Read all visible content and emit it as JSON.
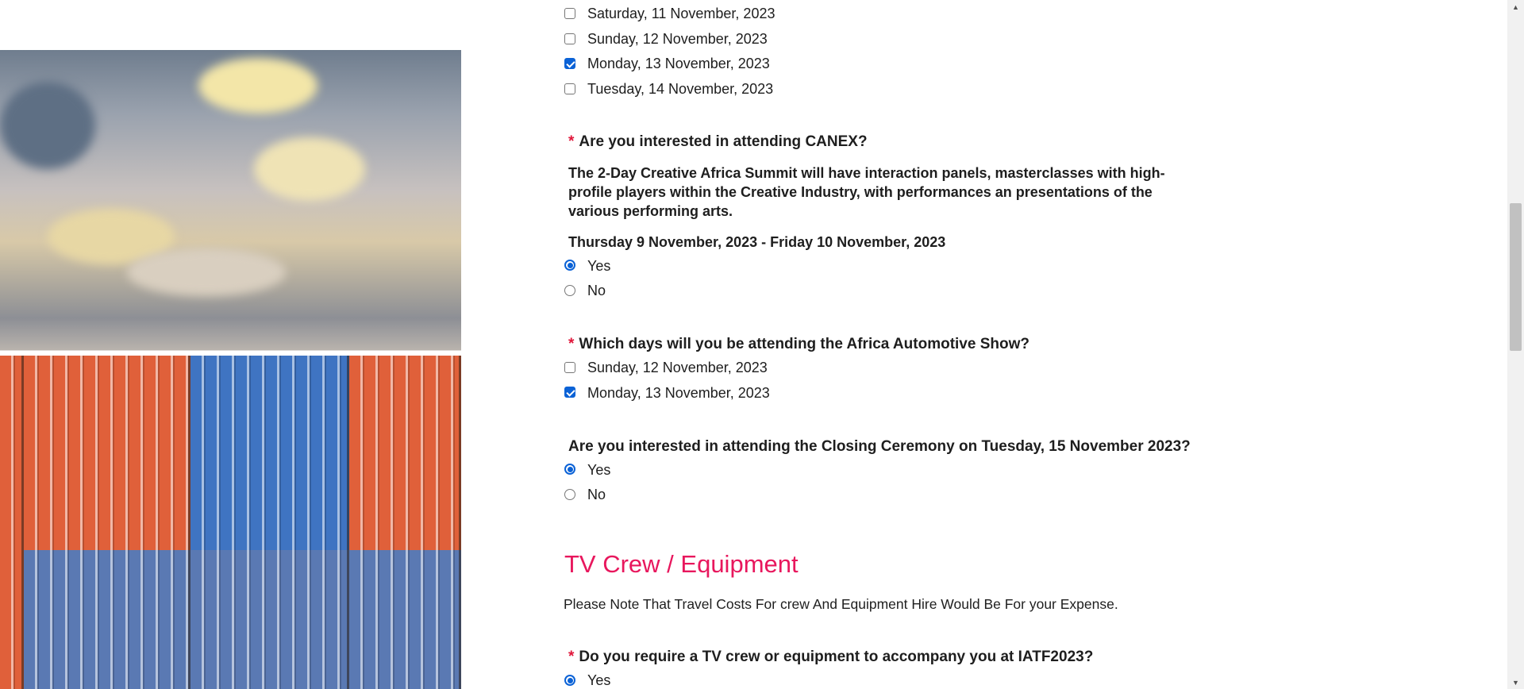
{
  "dates_group": {
    "options": [
      {
        "label": "Saturday, 11 November, 2023",
        "checked": false
      },
      {
        "label": "Sunday, 12 November, 2023",
        "checked": false
      },
      {
        "label": "Monday, 13 November, 2023",
        "checked": true
      },
      {
        "label": "Tuesday, 14 November, 2023",
        "checked": false
      }
    ]
  },
  "canex": {
    "required_mark": "*",
    "question": "Are you interested in attending CANEX?",
    "description_line1": "The 2-Day Creative Africa Summit will have interaction panels, masterclasses with high-",
    "description_line2": "profile players within the Creative Industry, with performances an presentations of the",
    "description_line3": "various performing arts.",
    "dates": "Thursday 9 November, 2023 - Friday 10 November, 2023",
    "options": [
      {
        "label": "Yes",
        "selected": true
      },
      {
        "label": "No",
        "selected": false
      }
    ]
  },
  "automotive": {
    "required_mark": "*",
    "question": "Which days will you be attending the Africa Automotive Show?",
    "options": [
      {
        "label": "Sunday, 12 November, 2023",
        "checked": false
      },
      {
        "label": "Monday, 13 November, 2023",
        "checked": true
      }
    ]
  },
  "closing": {
    "question": "Are you interested in attending the Closing Ceremony on Tuesday, 15 November 2023?",
    "options": [
      {
        "label": "Yes",
        "selected": true
      },
      {
        "label": "No",
        "selected": false
      }
    ]
  },
  "tv_section": {
    "title": "TV Crew / Equipment",
    "note": "Please Note That Travel Costs For crew And Equipment Hire Would Be For your Expense.",
    "required_mark": "*",
    "question": "Do you require a TV crew or equipment to accompany you at IATF2023?",
    "options": [
      {
        "label": "Yes",
        "selected": true
      }
    ]
  },
  "colors": {
    "accent_pink": "#e8175d",
    "required_red": "#e0163a",
    "control_blue": "#0b62d6"
  }
}
